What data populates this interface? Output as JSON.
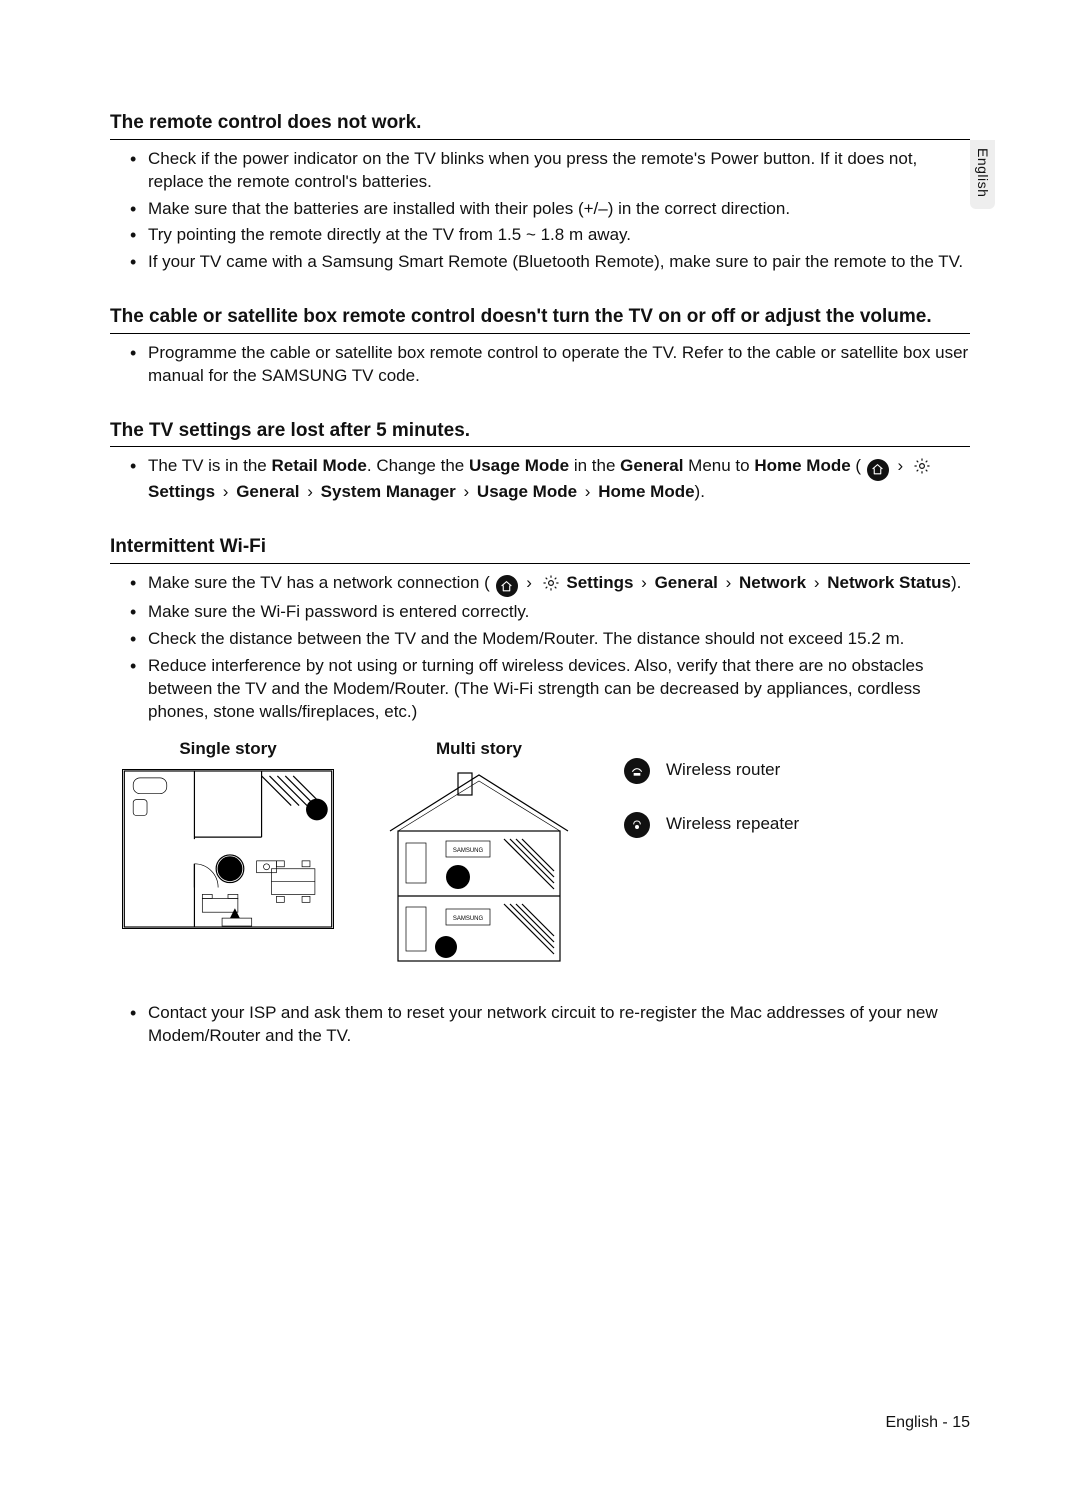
{
  "side_tab": "English",
  "sections": {
    "remote": {
      "title": "The remote control does not work.",
      "items": [
        "Check if the power indicator on the TV blinks when you press the remote's Power button. If it does not, replace the remote control's batteries.",
        "Make sure that the batteries are installed with their poles (+/–) in the correct direction.",
        "Try pointing the remote directly at the TV from 1.5 ~ 1.8 m away.",
        "If your TV came with a Samsung Smart Remote (Bluetooth Remote), make sure to pair the remote to the TV."
      ]
    },
    "cable": {
      "title": "The cable or satellite box remote control doesn't turn the TV on or off or adjust the volume.",
      "items": [
        "Programme the cable or satellite box remote control to operate the TV. Refer to the cable or satellite box user manual for the SAMSUNG TV code."
      ]
    },
    "settings": {
      "title": "The TV settings are lost after 5 minutes.",
      "path_parts": {
        "p1": "The TV is in the ",
        "retail": "Retail Mode",
        "p2": ". Change the ",
        "usage_mode_1": "Usage Mode",
        "p3": " in the ",
        "general_1": "General",
        "p4": " Menu to ",
        "home_mode_1": "Home Mode",
        "p5": " (",
        "sep": "›",
        "settings_lbl": "Settings",
        "general_2": "General",
        "system_mgr": "System Manager",
        "usage_mode_2": "Usage Mode",
        "home_mode_2": "Home Mode",
        "p6": ")."
      }
    },
    "wifi": {
      "title": "Intermittent Wi-Fi",
      "item1": {
        "p1": "Make sure the TV has a network connection (",
        "sep": "›",
        "settings_lbl": "Settings",
        "general": "General",
        "network": "Network",
        "status": "Network Status",
        "p2": ")."
      },
      "items_rest": [
        "Make sure the Wi-Fi password is entered correctly.",
        "Check the distance between the TV and the Modem/Router. The distance should not exceed 15.2 m.",
        "Reduce interference by not using or turning off wireless devices. Also, verify that there are no obstacles between the TV and the Modem/Router. (The Wi-Fi strength can be decreased by appliances, cordless phones, stone walls/fireplaces, etc.)"
      ],
      "after_items": [
        "Contact your ISP and ask them to reset your network circuit to re-register the Mac addresses of your new Modem/Router and the TV."
      ]
    }
  },
  "diagrams": {
    "single": "Single story",
    "multi": "Multi story",
    "tv_label": "SAMSUNG",
    "legend": {
      "router": "Wireless router",
      "repeater": "Wireless repeater"
    }
  },
  "footer": "English - 15"
}
